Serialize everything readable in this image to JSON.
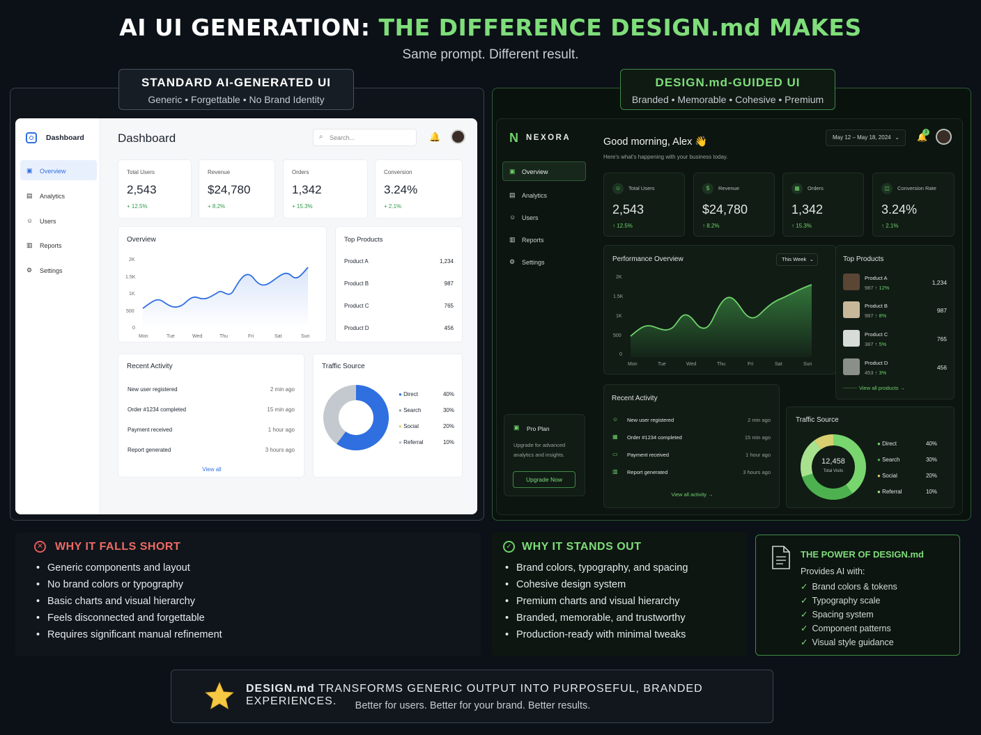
{
  "header": {
    "title_white": "AI UI GENERATION:",
    "title_green": "THE DIFFERENCE DESIGN.md MAKES",
    "subtitle": "Same prompt. Different result."
  },
  "left_tag": {
    "heading": "STANDARD AI-GENERATED UI",
    "sub": "Generic • Forgettable • No Brand Identity"
  },
  "right_tag": {
    "heading": "DESIGN.md-GUIDED UI",
    "sub": "Branded • Memorable • Cohesive • Premium"
  },
  "std": {
    "logo_label": "Dashboard",
    "nav": [
      "Overview",
      "Analytics",
      "Users",
      "Reports",
      "Settings"
    ],
    "page_title": "Dashboard",
    "search_placeholder": "Search...",
    "stats": [
      {
        "label": "Total Users",
        "value": "2,543",
        "delta": "+ 12.5%"
      },
      {
        "label": "Revenue",
        "value": "$24,780",
        "delta": "+ 8.2%"
      },
      {
        "label": "Orders",
        "value": "1,342",
        "delta": "+ 15.3%"
      },
      {
        "label": "Conversion",
        "value": "3.24%",
        "delta": "+ 2.1%"
      }
    ],
    "chart_title": "Overview",
    "chart_ticks": [
      "2K",
      "1.5K",
      "1K",
      "500",
      "0"
    ],
    "chart_days": [
      "Mon",
      "Tue",
      "Wed",
      "Thu",
      "Fri",
      "Sat",
      "Sun"
    ],
    "products_title": "Top Products",
    "products": [
      {
        "name": "Product A",
        "value": "1,234"
      },
      {
        "name": "Product B",
        "value": "987"
      },
      {
        "name": "Product C",
        "value": "765"
      },
      {
        "name": "Product D",
        "value": "456"
      }
    ],
    "activity_title": "Recent Activity",
    "activity": [
      {
        "text": "New user registered",
        "time": "2 min ago"
      },
      {
        "text": "Order #1234 completed",
        "time": "15 min ago"
      },
      {
        "text": "Payment received",
        "time": "1 hour ago"
      },
      {
        "text": "Report generated",
        "time": "3 hours ago"
      }
    ],
    "view_all": "View all",
    "traffic_title": "Traffic Source",
    "traffic": [
      {
        "name": "Direct",
        "pct": "40%",
        "color": "#2f6fe0"
      },
      {
        "name": "Search",
        "pct": "30%",
        "color": "#9aa3ae"
      },
      {
        "name": "Social",
        "pct": "20%",
        "color": "#c8cdd3"
      },
      {
        "name": "Referral",
        "pct": "10%",
        "color": "#b6bcc4"
      }
    ]
  },
  "nexora": {
    "brand": "NEXORA",
    "nav": [
      "Overview",
      "Analytics",
      "Users",
      "Reports",
      "Settings"
    ],
    "greeting": "Good morning, Alex 👋",
    "greeting_sub": "Here's what's happening with your business today.",
    "date_range": "May 12 – May 18, 2024",
    "notif_count": "3",
    "stats": [
      {
        "label": "Total Users",
        "value": "2,543",
        "delta": "↑ 12.5%"
      },
      {
        "label": "Revenue",
        "value": "$24,780",
        "delta": "↑ 8.2%"
      },
      {
        "label": "Orders",
        "value": "1,342",
        "delta": "↑ 15.3%"
      },
      {
        "label": "Conversion Rate",
        "value": "3.24%",
        "delta": "↑ 2.1%"
      }
    ],
    "perf_title": "Performance Overview",
    "perf_range": "This Week",
    "chart_ticks": [
      "2K",
      "1.5K",
      "1K",
      "500",
      "0"
    ],
    "chart_days": [
      "Mon",
      "Tue",
      "Wed",
      "Thu",
      "Fri",
      "Sat",
      "Sun"
    ],
    "products_title": "Top Products",
    "products": [
      {
        "name": "Product A",
        "sub": "987",
        "delta": "↑ 12%",
        "value": "1,234"
      },
      {
        "name": "Product B",
        "sub": "987",
        "delta": "↑ 8%",
        "value": "987"
      },
      {
        "name": "Product C",
        "sub": "387",
        "delta": "↑ 5%",
        "value": "765"
      },
      {
        "name": "Product D",
        "sub": "453",
        "delta": "↑ 3%",
        "value": "456"
      }
    ],
    "view_all_products": "View all products →",
    "pro_title": "Pro Plan",
    "pro_text": "Upgrade for advanced analytics and insights.",
    "pro_button": "Upgrade Now",
    "activity_title": "Recent Activity",
    "activity": [
      {
        "text": "New user registered",
        "time": "2 min ago"
      },
      {
        "text": "Order #1234 completed",
        "time": "15 min ago"
      },
      {
        "text": "Payment received",
        "time": "1 hour ago"
      },
      {
        "text": "Report generated",
        "time": "3 hours ago"
      }
    ],
    "view_all_activity": "View all activity →",
    "traffic_title": "Traffic Source",
    "traffic_total": "12,458",
    "traffic_total_label": "Total Visits",
    "traffic": [
      {
        "name": "Direct",
        "pct": "40%"
      },
      {
        "name": "Search",
        "pct": "30%"
      },
      {
        "name": "Social",
        "pct": "20%"
      },
      {
        "name": "Referral",
        "pct": "10%"
      }
    ]
  },
  "falls_short": {
    "title": "WHY IT FALLS SHORT",
    "items": [
      "Generic components and layout",
      "No brand colors or typography",
      "Basic charts and visual hierarchy",
      "Feels disconnected and forgettable",
      "Requires significant manual refinement"
    ]
  },
  "stands_out": {
    "title": "WHY IT STANDS OUT",
    "items": [
      "Brand colors, typography, and spacing",
      "Cohesive design system",
      "Premium charts and visual hierarchy",
      "Branded, memorable, and trustworthy",
      "Production-ready with minimal tweaks"
    ]
  },
  "power": {
    "title": "THE POWER OF DESIGN.md",
    "intro": "Provides AI with:",
    "items": [
      "Brand colors & tokens",
      "Typography scale",
      "Spacing system",
      "Component patterns",
      "Visual style guidance"
    ]
  },
  "footer": {
    "bold": "DESIGN.md",
    "rest": " TRANSFORMS GENERIC OUTPUT INTO PURPOSEFUL, BRANDED EXPERIENCES.",
    "sub": "Better for users. Better for your brand. Better results."
  }
}
